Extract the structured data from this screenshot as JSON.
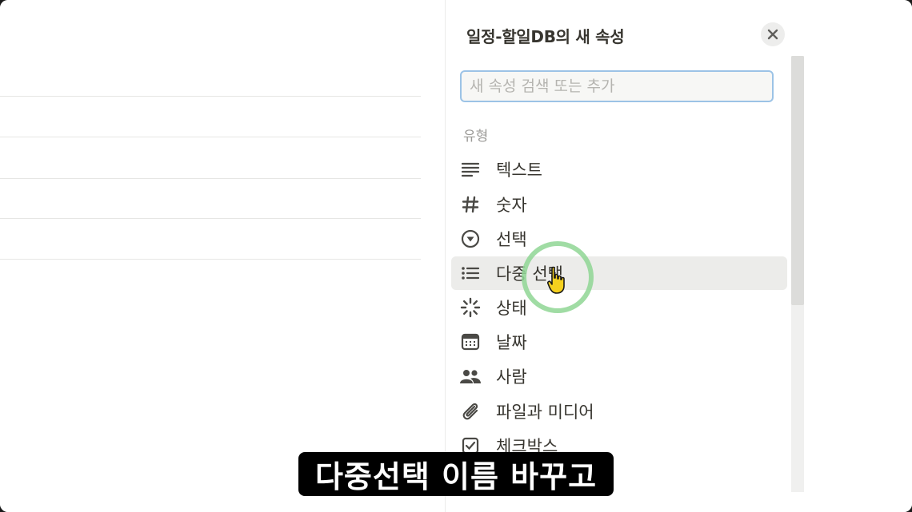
{
  "panel": {
    "title": "일정-할일DB의 새 속성",
    "search_placeholder": "새 속성 검색 또는 추가",
    "section_label": "유형",
    "items": [
      {
        "label": "텍스트",
        "icon": "text-lines-icon"
      },
      {
        "label": "숫자",
        "icon": "hash-icon"
      },
      {
        "label": "선택",
        "icon": "select-circle-icon"
      },
      {
        "label": "다중 선택",
        "icon": "multi-select-list-icon"
      },
      {
        "label": "상태",
        "icon": "status-spinner-icon"
      },
      {
        "label": "날짜",
        "icon": "calendar-icon"
      },
      {
        "label": "사람",
        "icon": "people-icon"
      },
      {
        "label": "파일과 미디어",
        "icon": "paperclip-icon"
      },
      {
        "label": "체크박스",
        "icon": "checkbox-icon"
      }
    ]
  },
  "subtitle": "다중선택 이름 바꾸고",
  "colors": {
    "hover_bg": "#ececea",
    "click_ring": "#8fd694",
    "search_border": "#9cc3e6"
  }
}
